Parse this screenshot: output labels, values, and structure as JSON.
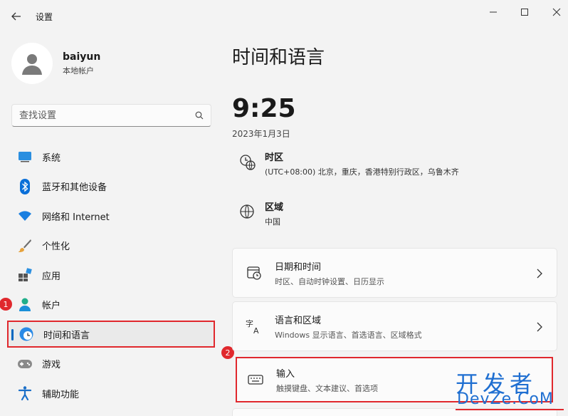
{
  "window": {
    "title": "设置",
    "back_icon": "back-arrow-icon"
  },
  "profile": {
    "name": "baiyun",
    "account_type": "本地帐户"
  },
  "search": {
    "placeholder": "查找设置"
  },
  "sidebar": {
    "items": [
      {
        "label": "系统",
        "icon": "monitor-icon"
      },
      {
        "label": "蓝牙和其他设备",
        "icon": "bluetooth-icon"
      },
      {
        "label": "网络和 Internet",
        "icon": "wifi-icon"
      },
      {
        "label": "个性化",
        "icon": "brush-icon"
      },
      {
        "label": "应用",
        "icon": "apps-icon"
      },
      {
        "label": "帐户",
        "icon": "person-icon"
      },
      {
        "label": "时间和语言",
        "icon": "clock-globe-icon",
        "selected": true
      },
      {
        "label": "游戏",
        "icon": "gamepad-icon"
      },
      {
        "label": "辅助功能",
        "icon": "accessibility-icon"
      }
    ]
  },
  "annotations": {
    "step1": "1",
    "step2": "2"
  },
  "main": {
    "page_title": "时间和语言",
    "time": "9:25",
    "date": "2023年1月3日",
    "timezone": {
      "title": "时区",
      "value": "(UTC+08:00) 北京，重庆，香港特别行政区，乌鲁木齐"
    },
    "region": {
      "title": "区域",
      "value": "中国"
    },
    "cards": [
      {
        "title": "日期和时间",
        "subtitle": "时区、自动时钟设置、日历显示",
        "icon": "calendar-clock-icon"
      },
      {
        "title": "语言和区域",
        "subtitle": "Windows 显示语言、首选语言、区域格式",
        "icon": "language-icon"
      },
      {
        "title": "输入",
        "subtitle": "触摸键盘、文本建议、首选项",
        "icon": "keyboard-icon"
      }
    ]
  },
  "watermark": {
    "top": "开发者",
    "bottom": "DevZe.CoM"
  },
  "colors": {
    "accent": "#0067c0",
    "highlight_red": "#e0282d",
    "background": "#f3f3f3",
    "card": "#fbfbfb"
  }
}
